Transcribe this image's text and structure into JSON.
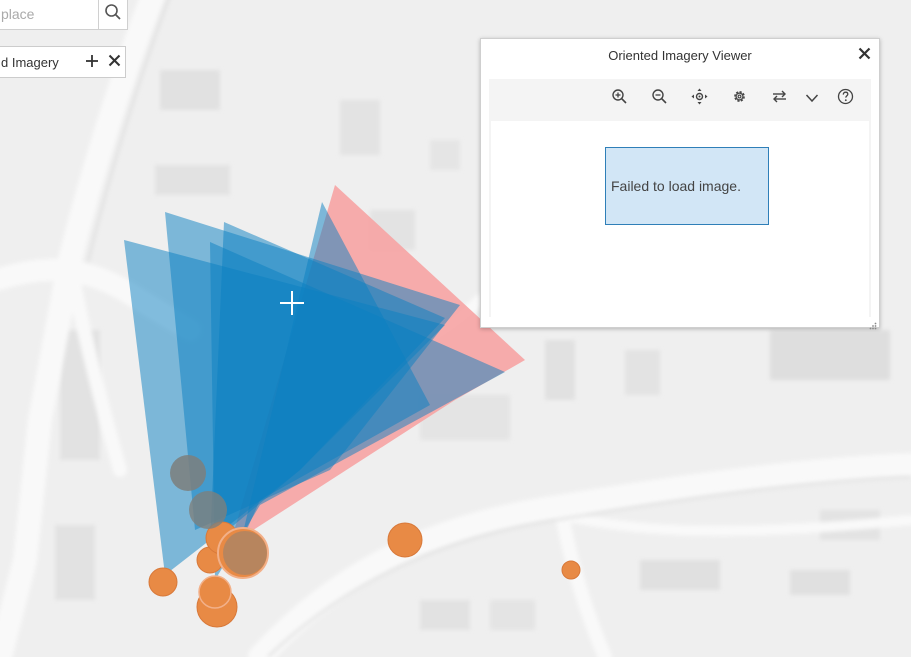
{
  "search": {
    "placeholder": "place"
  },
  "layer_chip": {
    "label": "d Imagery"
  },
  "viewer": {
    "title": "Oriented Imagery Viewer",
    "message": "Failed to load image.",
    "toolbar": [
      "zoom-in-icon",
      "zoom-out-icon",
      "pan-icon",
      "settings-icon",
      "swap-icon",
      "chevron-down-icon",
      "help-icon"
    ]
  },
  "colors": {
    "camera_blue": "#0a7fc1",
    "camera_red": "#f6a3a3",
    "point_orange": "#e88a45",
    "point_gray": "#7d7f7d",
    "message_bg": "#d2e6f6",
    "message_border": "#2f7fb8"
  }
}
